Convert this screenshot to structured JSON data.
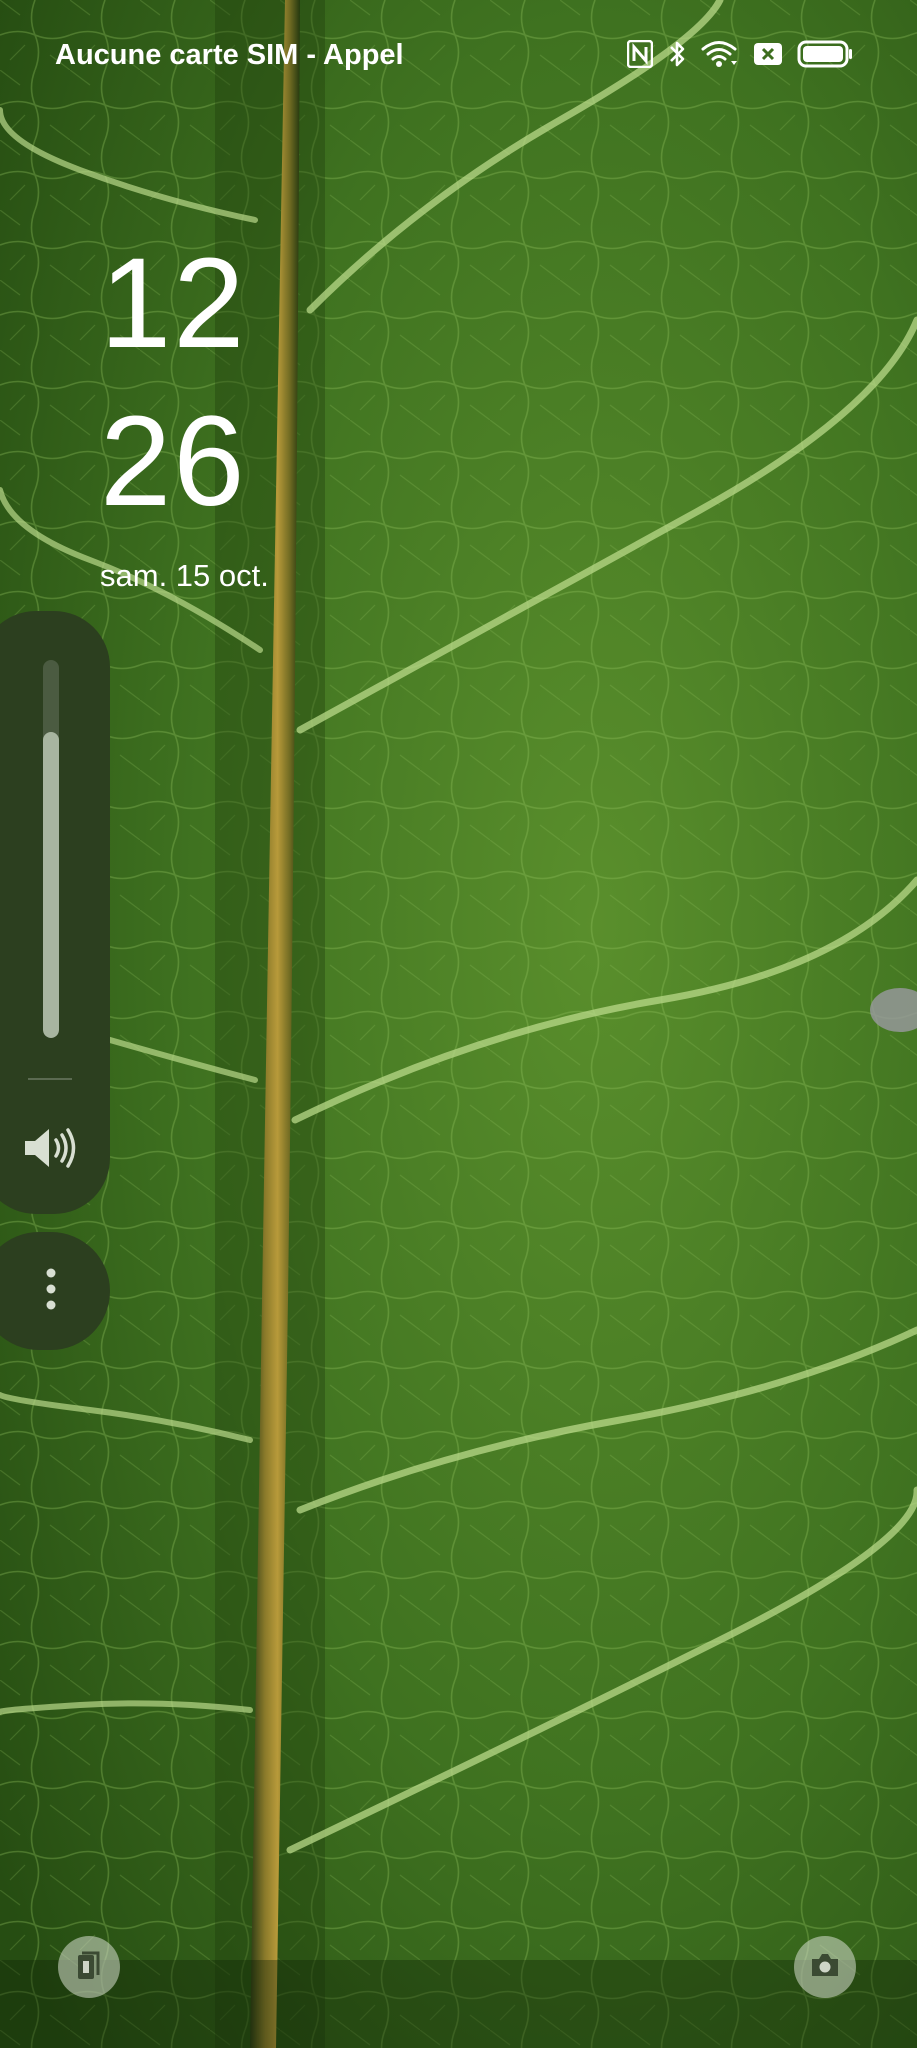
{
  "status_bar": {
    "carrier": "Aucune carte SIM - Appel",
    "icons": [
      "nfc-icon",
      "bluetooth-icon",
      "wifi-icon",
      "no-sim-icon",
      "battery-icon"
    ],
    "battery_level": 1.0
  },
  "lock_screen": {
    "hour": "12",
    "minute": "26",
    "date": "sam. 15 oct."
  },
  "volume": {
    "level": 0.81,
    "speaker_icon": "speaker-icon",
    "more_icon": "more-vertical-icon"
  },
  "shortcuts": {
    "left_icon": "wallet-icon",
    "right_icon": "camera-icon"
  },
  "colors": {
    "panel": "#2c3f1f",
    "leaf": "#3d6e1e"
  }
}
